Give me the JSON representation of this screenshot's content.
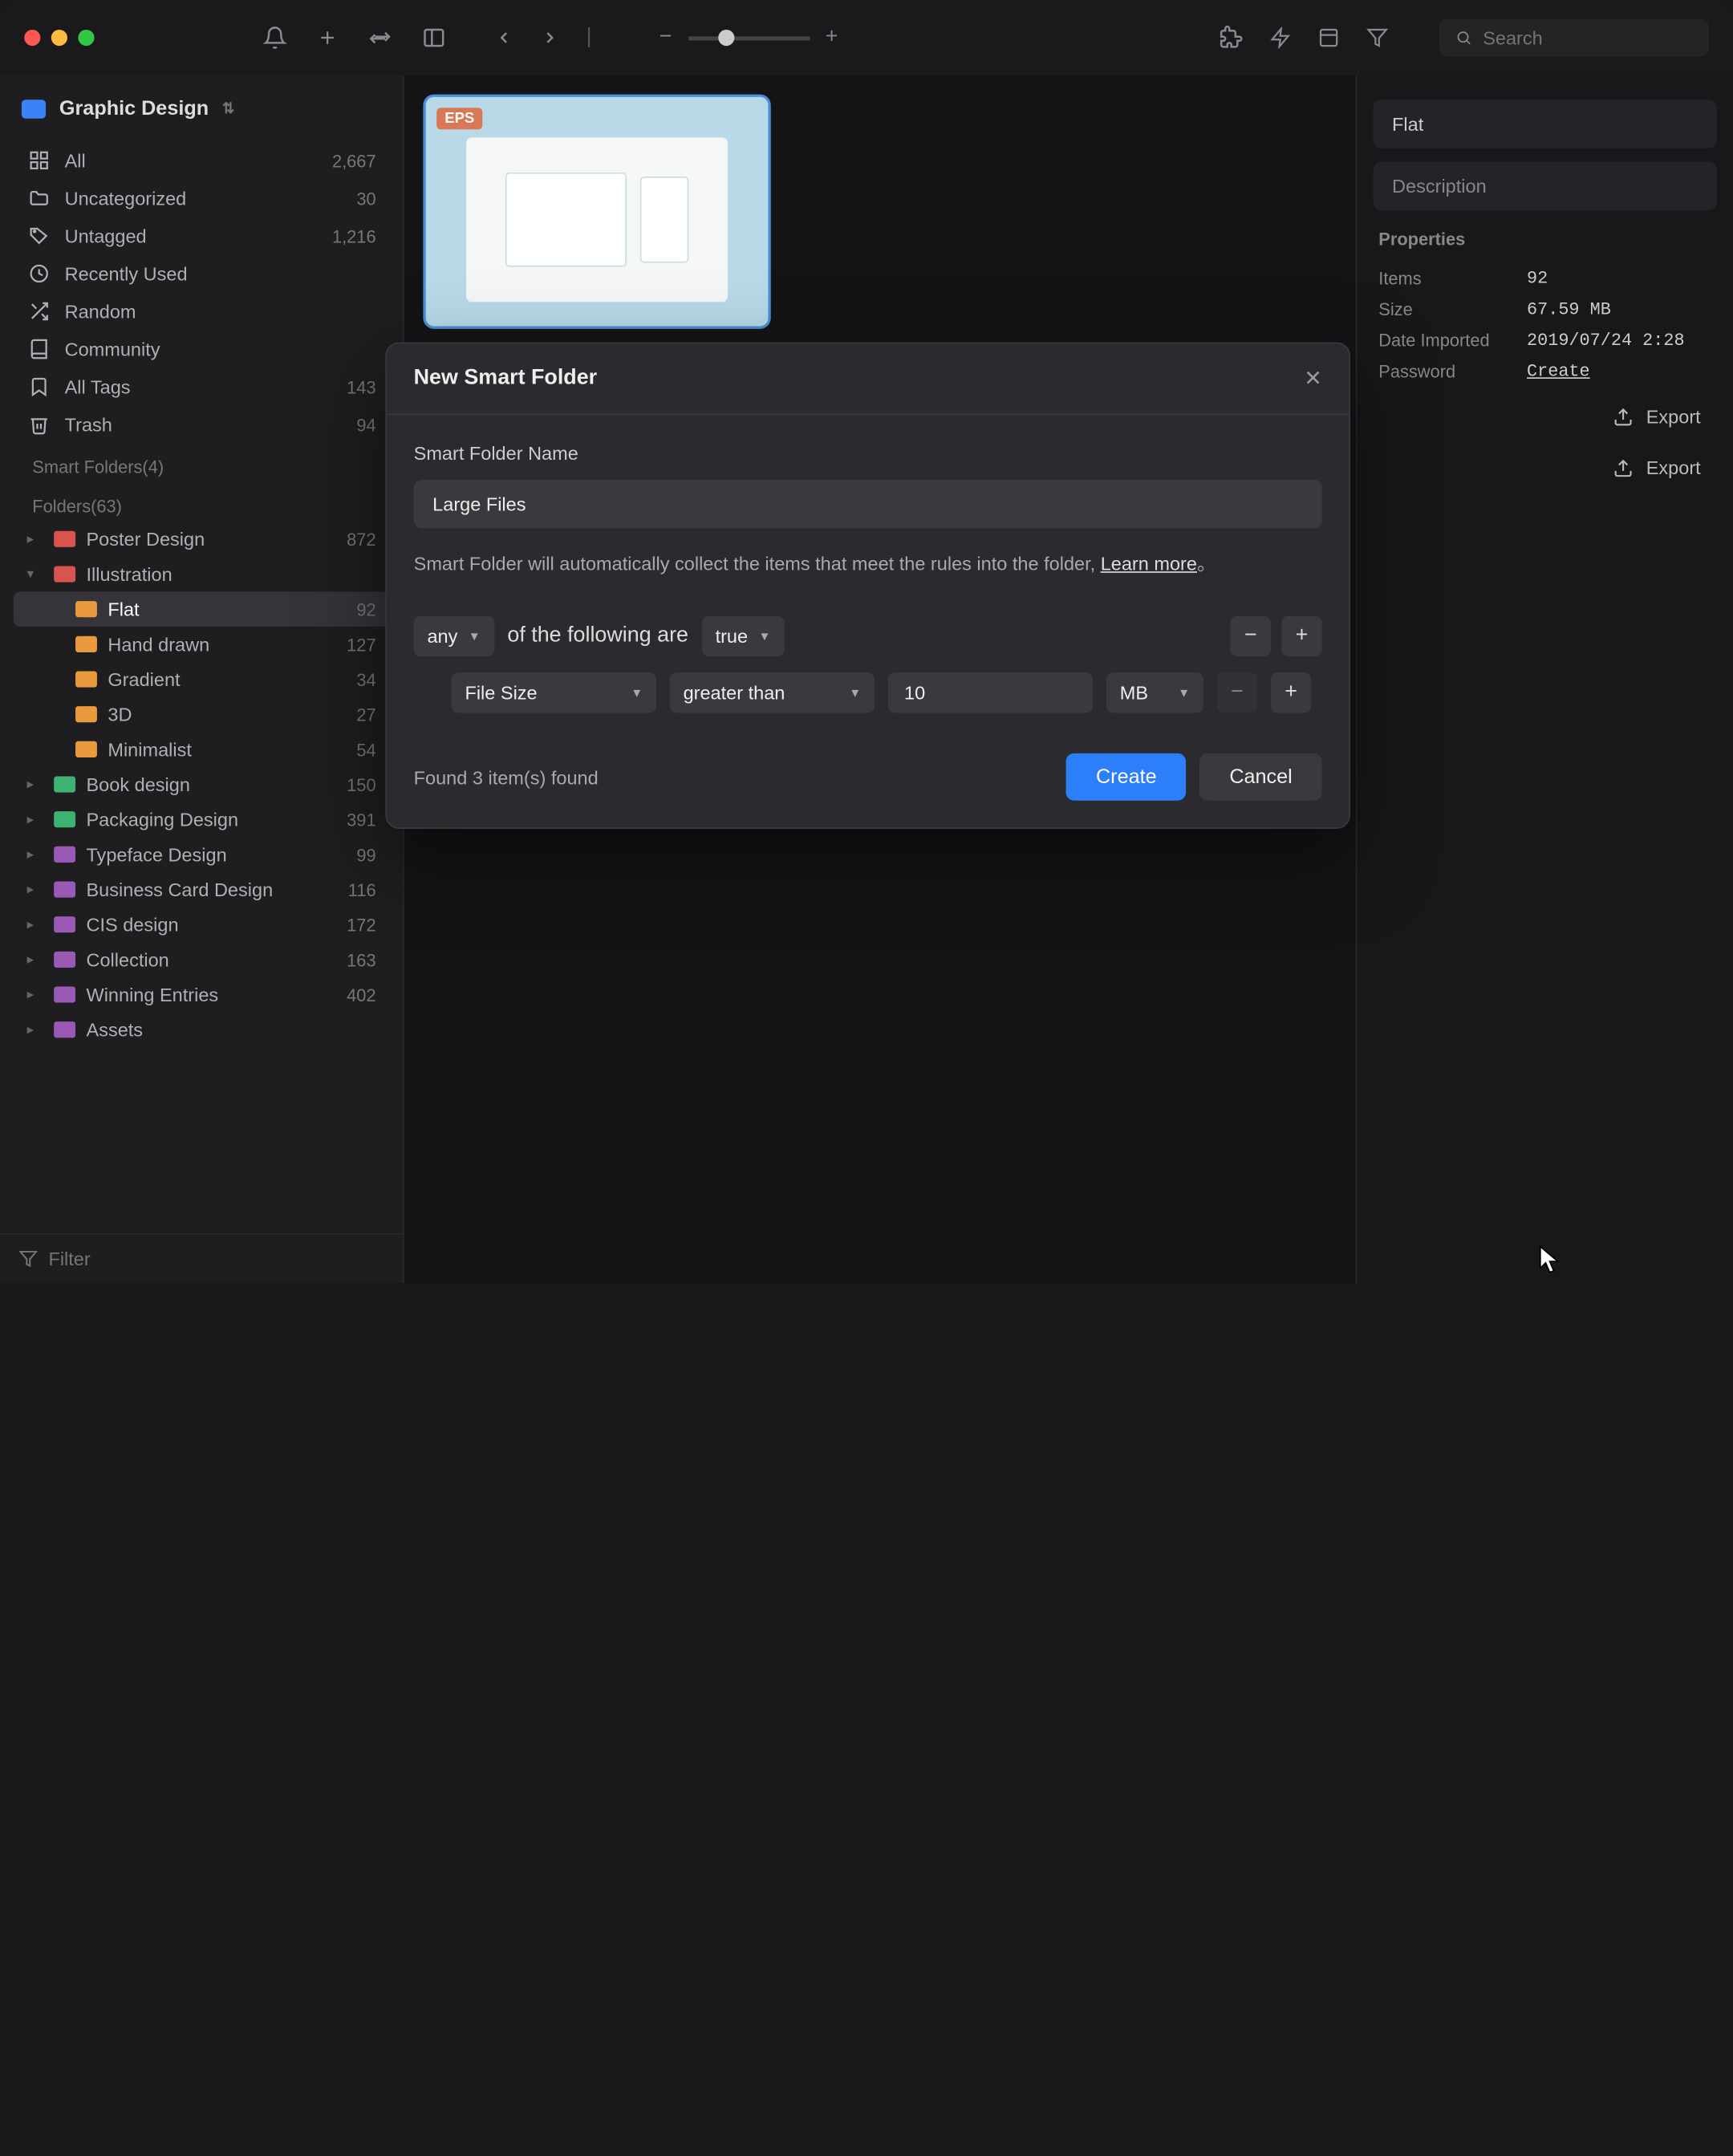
{
  "library": {
    "name": "Graphic Design"
  },
  "titlebar": {
    "search_placeholder": "Search"
  },
  "sidebar": {
    "items": [
      {
        "icon": "grid",
        "label": "All",
        "count": "2,667"
      },
      {
        "icon": "folder",
        "label": "Uncategorized",
        "count": "30"
      },
      {
        "icon": "tag",
        "label": "Untagged",
        "count": "1,216"
      },
      {
        "icon": "clock",
        "label": "Recently Used",
        "count": ""
      },
      {
        "icon": "shuffle",
        "label": "Random",
        "count": ""
      },
      {
        "icon": "book",
        "label": "Community",
        "count": ""
      },
      {
        "icon": "bookmark",
        "label": "All Tags",
        "count": "143"
      },
      {
        "icon": "trash",
        "label": "Trash",
        "count": "94"
      }
    ],
    "smart_folders_header": "Smart Folders(4)",
    "folders_header": "Folders(63)",
    "folders": [
      {
        "color": "#d9534f",
        "label": "Poster Design",
        "count": "872",
        "expanded": false
      },
      {
        "color": "#d9534f",
        "label": "Illustration",
        "count": "",
        "expanded": true,
        "children": [
          {
            "color": "#e89a3c",
            "label": "Flat",
            "count": "92",
            "active": true
          },
          {
            "color": "#e89a3c",
            "label": "Hand drawn",
            "count": "127"
          },
          {
            "color": "#e89a3c",
            "label": "Gradient",
            "count": "34"
          },
          {
            "color": "#e89a3c",
            "label": "3D",
            "count": "27"
          },
          {
            "color": "#e89a3c",
            "label": "Minimalist",
            "count": "54"
          }
        ]
      },
      {
        "color": "#3cb371",
        "label": "Book design",
        "count": "150"
      },
      {
        "color": "#3cb371",
        "label": "Packaging Design",
        "count": "391"
      },
      {
        "color": "#9b59b6",
        "label": "Typeface Design",
        "count": "99"
      },
      {
        "color": "#9b59b6",
        "label": "Business Card Design",
        "count": "116"
      },
      {
        "color": "#9b59b6",
        "label": "CIS design",
        "count": "172"
      },
      {
        "color": "#9b59b6",
        "label": "Collection",
        "count": "163"
      },
      {
        "color": "#9b59b6",
        "label": "Winning Entries",
        "count": "402"
      },
      {
        "color": "#9b59b6",
        "label": "Assets",
        "count": ""
      }
    ],
    "filter_placeholder": "Filter"
  },
  "content": {
    "badge": "EPS"
  },
  "inspector": {
    "name": "Flat",
    "description_placeholder": "Description",
    "properties_header": "Properties",
    "rows": [
      {
        "label": "Items",
        "value": "92"
      },
      {
        "label": "Size",
        "value": "67.59 MB"
      },
      {
        "label": "Date Imported",
        "value": "2019/07/24 2:28"
      },
      {
        "label": "Password",
        "value": "Create",
        "link": true
      }
    ],
    "export_label": "Export"
  },
  "dialog": {
    "title": "New Smart Folder",
    "name_label": "Smart Folder Name",
    "name_value": "Large Files",
    "description": "Smart Folder will automatically collect the items that meet the rules into the folder, ",
    "learn_more": "Learn more",
    "match_mode": "any",
    "match_text": "of the following are",
    "match_bool": "true",
    "rule": {
      "field": "File Size",
      "operator": "greater than",
      "value": "10",
      "unit": "MB"
    },
    "found_text": "Found 3 item(s) found",
    "create_label": "Create",
    "cancel_label": "Cancel"
  }
}
